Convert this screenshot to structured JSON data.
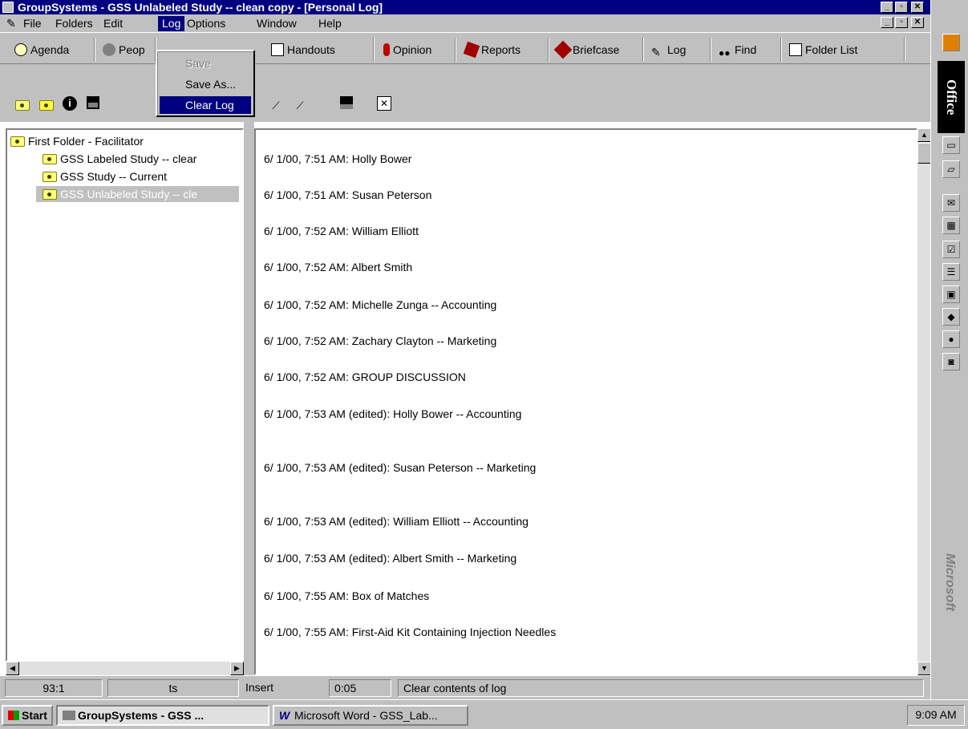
{
  "window": {
    "title": "GroupSystems - GSS Unlabeled Study -- clean copy - [Personal Log]"
  },
  "menubar": {
    "items": [
      "File",
      "Folders",
      "Edit",
      "Log",
      "Options",
      "Window",
      "Help"
    ]
  },
  "log_menu": {
    "items": [
      {
        "label": "Save",
        "enabled": false
      },
      {
        "label": "Save As...",
        "enabled": true
      },
      {
        "label": "Clear Log",
        "enabled": true,
        "highlighted": true
      }
    ]
  },
  "toolbar": {
    "agenda": "Agenda",
    "people": "Peop",
    "handouts": "Handouts",
    "opinion": "Opinion",
    "reports": "Reports",
    "briefcase": "Briefcase",
    "log": "Log",
    "find": "Find",
    "folder_list": "Folder List"
  },
  "tree": {
    "items": [
      {
        "label": "First Folder - Facilitator",
        "level": 0,
        "selected": false
      },
      {
        "label": "GSS Labeled Study -- clear",
        "level": 1,
        "selected": false
      },
      {
        "label": "GSS Study -- Current",
        "level": 1,
        "selected": false
      },
      {
        "label": "GSS Unlabeled Study -- cle",
        "level": 1,
        "selected": true
      }
    ]
  },
  "log_entries": [
    "6/ 1/00,  7:51 AM: Holly Bower",
    "6/ 1/00,  7:51 AM: Susan Peterson",
    "6/ 1/00,  7:52 AM: William Elliott",
    "6/ 1/00,  7:52 AM: Albert Smith",
    "6/ 1/00,  7:52 AM: Michelle Zunga -- Accounting",
    "6/ 1/00,  7:52 AM: Zachary Clayton -- Marketing",
    "6/ 1/00,  7:52 AM: GROUP DISCUSSION",
    "6/ 1/00,  7:53 AM (edited): Holly Bower -- Accounting",
    "6/ 1/00,  7:53 AM (edited): Susan Peterson -- Marketing",
    "6/ 1/00,  7:53 AM (edited): William Elliott -- Accounting",
    "6/ 1/00,  7:53 AM (edited): Albert Smith -- Marketing",
    "6/ 1/00,  7:55 AM: Box of Matches",
    "6/ 1/00,  7:55 AM: First-Aid Kit Containing Injection Needles"
  ],
  "status": {
    "position": "93:1",
    "field2": "ts",
    "mode": "Insert",
    "time": "0:05",
    "message": "Clear contents of log"
  },
  "taskbar": {
    "start": "Start",
    "task1": "GroupSystems - GSS ...",
    "task2": "Microsoft Word - GSS_Lab...",
    "clock": "9:09 AM"
  },
  "officebar": {
    "title": "Office",
    "brand": "Microsoft"
  },
  "colors": {
    "titlebar": "#000080",
    "face": "#c0c0c0",
    "highlight": "#000080"
  }
}
